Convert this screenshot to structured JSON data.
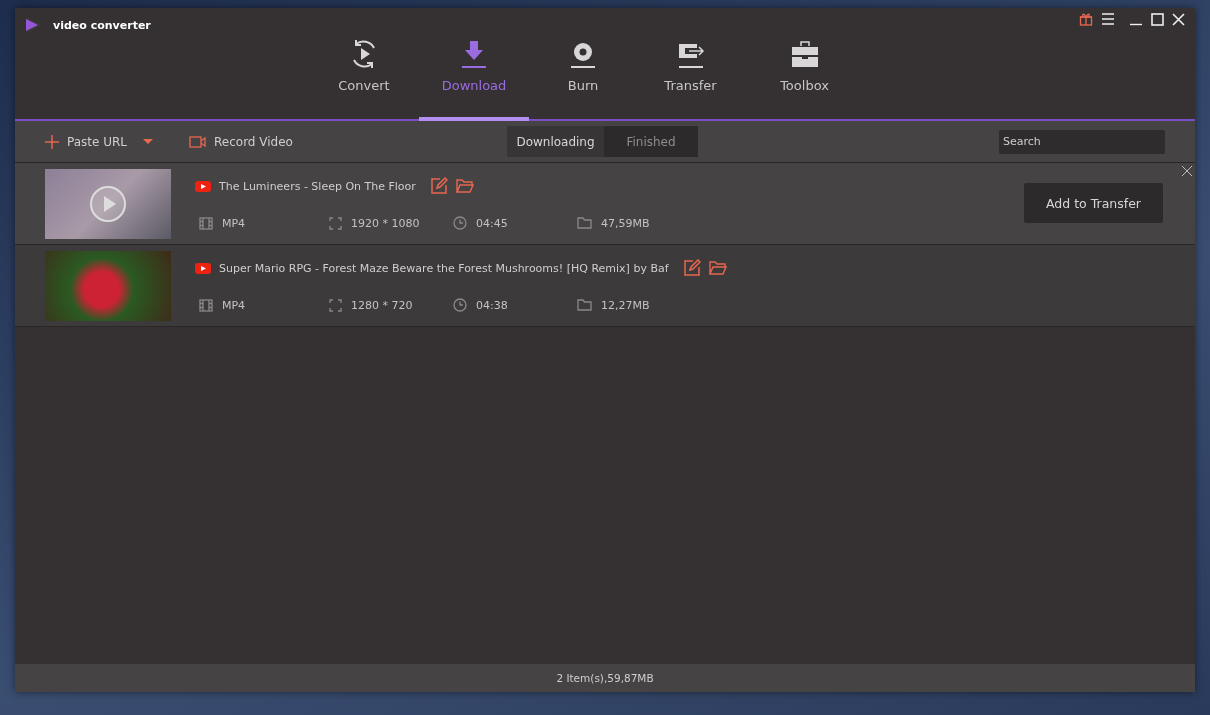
{
  "app": {
    "title": "video converter"
  },
  "main_tabs": [
    {
      "label": "Convert",
      "kind": "convert",
      "selected": false
    },
    {
      "label": "Download",
      "kind": "download",
      "selected": true
    },
    {
      "label": "Burn",
      "kind": "burn",
      "selected": false
    },
    {
      "label": "Transfer",
      "kind": "transfer",
      "selected": false
    },
    {
      "label": "Toolbox",
      "kind": "toolbox",
      "selected": false
    }
  ],
  "toolbar": {
    "paste_url": "Paste URL",
    "record_video": "Record Video",
    "sub_tabs": [
      {
        "label": "Downloading",
        "selected": true
      },
      {
        "label": "Finished",
        "selected": false
      }
    ],
    "search": {
      "placeholder": "Search"
    }
  },
  "items": [
    {
      "title": "The Lumineers - Sleep On The Floor",
      "kind": "playable",
      "format": "MP4",
      "resolution": "1920 * 1080",
      "duration": "04:45",
      "size": "47,59MB",
      "hovered": true,
      "action": "Add to Transfer"
    },
    {
      "title": "Super Mario RPG - Forest Maze  Beware the Forest Mushrooms! [HQ Remix] by Baf",
      "kind": "plain",
      "format": "MP4",
      "resolution": "1280 * 720",
      "duration": "04:38",
      "size": "12,27MB",
      "hovered": false
    }
  ],
  "status_bar": "2 Item(s),59,87MB"
}
